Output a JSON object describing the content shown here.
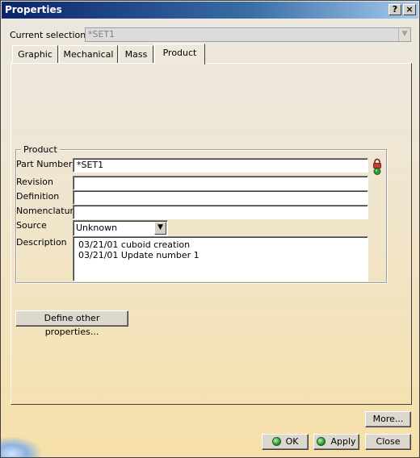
{
  "window": {
    "title": "Properties"
  },
  "titlebar_buttons": {
    "help": "?",
    "close": "×"
  },
  "selection": {
    "label": "Current selection :",
    "value": "*SET1"
  },
  "tabs": [
    {
      "label": "Graphic",
      "active": false
    },
    {
      "label": "Mechanical",
      "active": false
    },
    {
      "label": "Mass",
      "active": false
    },
    {
      "label": "Product",
      "active": true
    }
  ],
  "product": {
    "group_title": "Product",
    "part_number": {
      "label": "Part Number",
      "value": "*SET1"
    },
    "revision": {
      "label": "Revision",
      "value": ""
    },
    "definition": {
      "label": "Definition",
      "value": ""
    },
    "nomenclature": {
      "label": "Nomenclature",
      "value": ""
    },
    "source": {
      "label": "Source",
      "value": "Unknown"
    },
    "description": {
      "label": "Description",
      "lines": [
        "03/21/01 cuboid creation",
        "03/21/01 Update number 1"
      ]
    }
  },
  "buttons": {
    "define_other": "Define other properties...",
    "more": "More...",
    "ok": "OK",
    "apply": "Apply",
    "close": "Close"
  },
  "icons": {
    "part_number_icon": "lock-status-icon",
    "ok_icon": "green-dot-icon",
    "apply_icon": "green-dot-icon"
  },
  "colors": {
    "titlebar_start": "#0a246a",
    "titlebar_end": "#a6caf0",
    "status_green": "#2e9e2e"
  }
}
